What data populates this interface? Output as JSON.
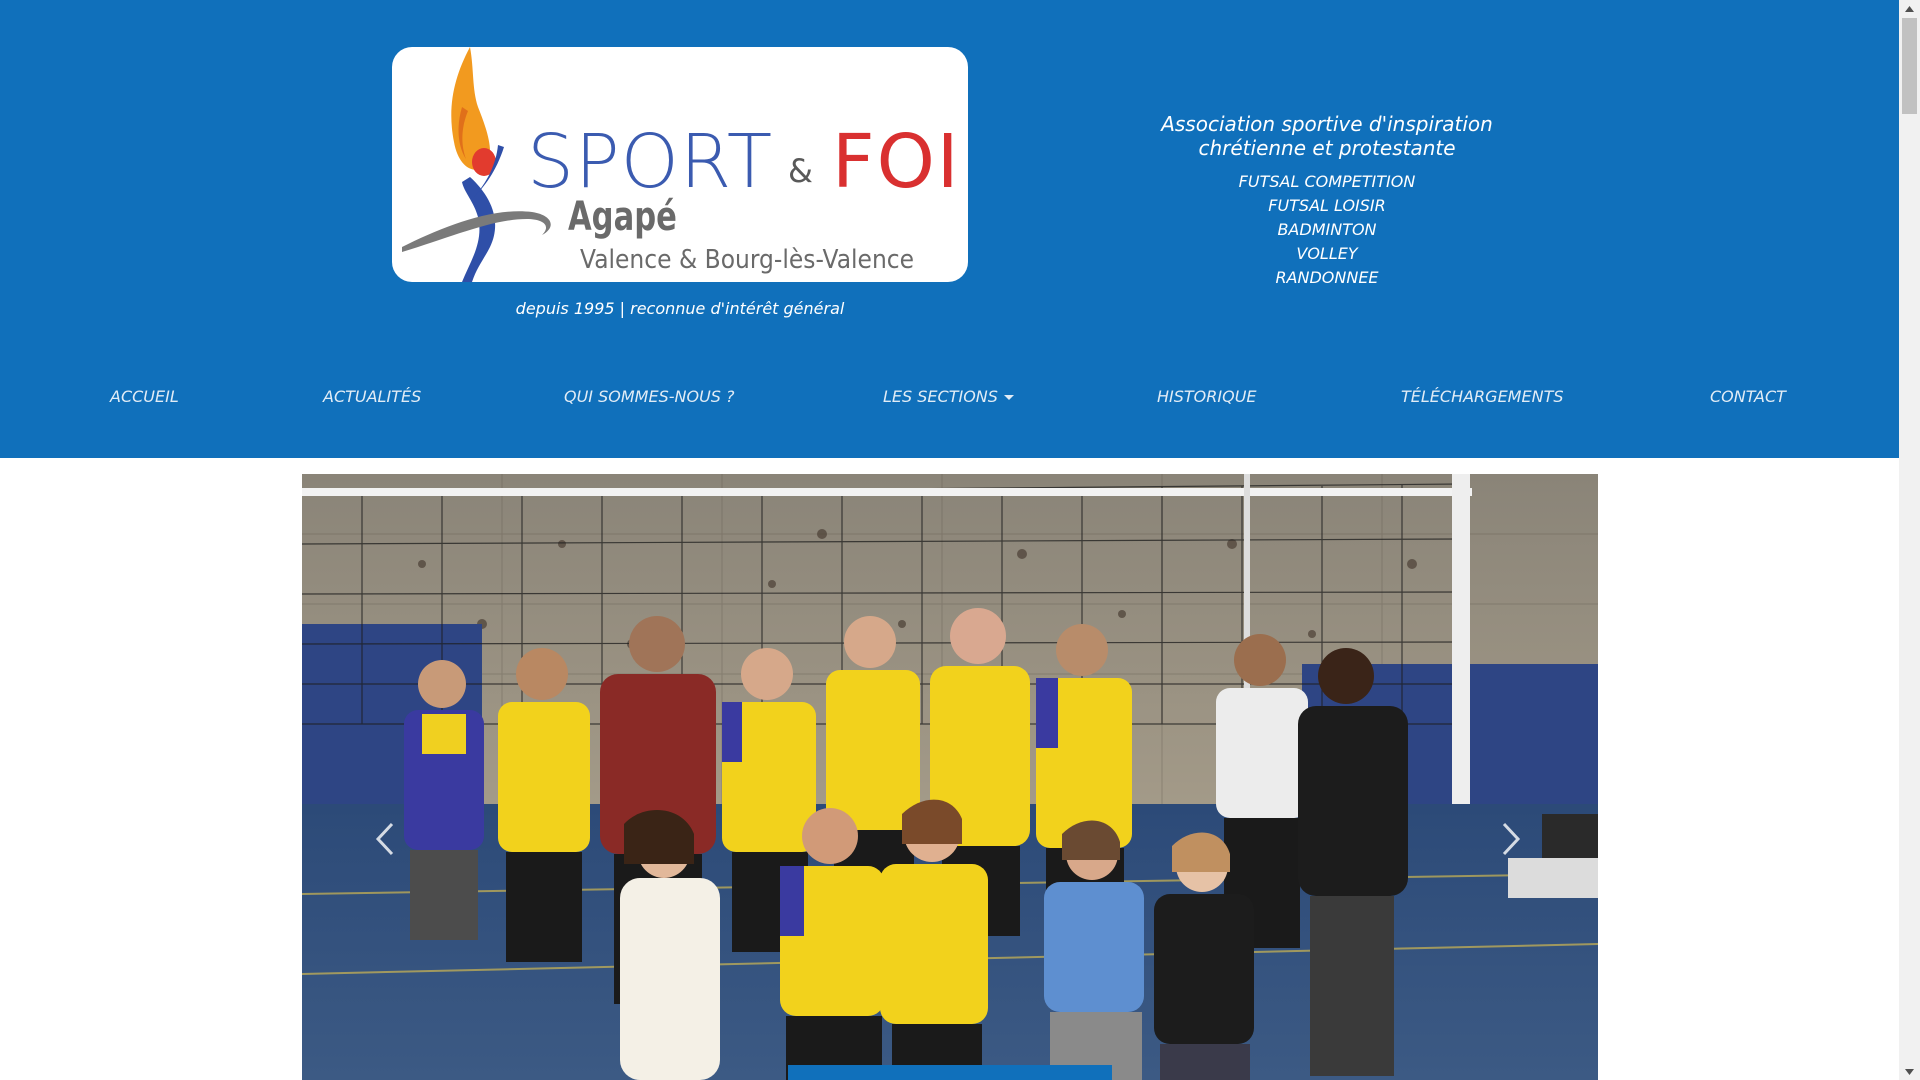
{
  "header": {
    "logo": {
      "sport": "SPORT",
      "amp": "&",
      "foi": "FOI",
      "agape": "Agapé",
      "city": "Valence & Bourg-lès-Valence"
    },
    "tagline": "depuis 1995 | reconnue d'intérêt général",
    "association": {
      "title_line1": "Association sportive d'inspiration",
      "title_line2": "chrétienne et protestante",
      "sections": [
        "FUTSAL COMPETITION",
        "FUTSAL LOISIR",
        "BADMINTON",
        "VOLLEY",
        "RANDONNEE"
      ]
    }
  },
  "nav": {
    "items": [
      "ACCUEIL",
      "ACTUALITÉS",
      "QUI SOMMES-NOUS ?",
      "LES SECTIONS",
      "HISTORIQUE",
      "TÉLÉCHARGEMENTS",
      "CONTACT"
    ]
  },
  "colors": {
    "brand_blue": "#1070bb",
    "logo_blue": "#3b5bb0",
    "logo_red": "#d93030",
    "logo_orange": "#f29a1f"
  },
  "carousel": {
    "prev_icon": "chevron-left-icon",
    "next_icon": "chevron-right-icon"
  }
}
